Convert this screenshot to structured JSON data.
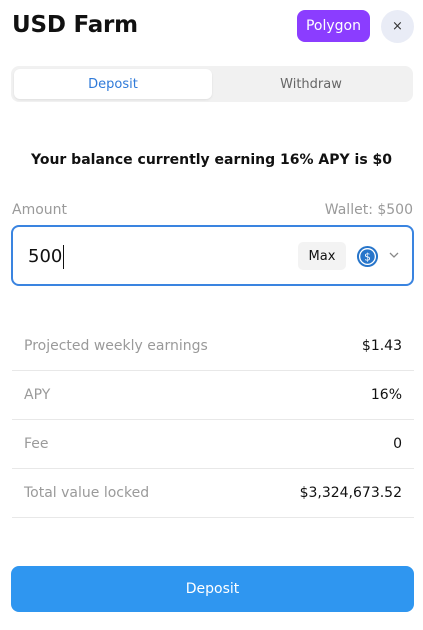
{
  "header": {
    "title": "USD Farm",
    "network_badge": "Polygon",
    "close_label": "×"
  },
  "tabs": [
    {
      "label": "Deposit",
      "active": true
    },
    {
      "label": "Withdraw",
      "active": false
    }
  ],
  "balance_text": "Your balance currently earning 16% APY is $0",
  "amount": {
    "label": "Amount",
    "wallet": "Wallet: $500",
    "value": "500",
    "max_label": "Max",
    "token_icon": "usdc-coin-icon"
  },
  "stats": [
    {
      "label": "Projected weekly earnings",
      "value": "$1.43"
    },
    {
      "label": "APY",
      "value": "16%"
    },
    {
      "label": "Fee",
      "value": "0"
    },
    {
      "label": "Total value locked",
      "value": "$3,324,673.52"
    }
  ],
  "deposit_button": "Deposit",
  "colors": {
    "accent": "#2f96f0",
    "badge": "#8b3dff",
    "input_border": "#3a84e0",
    "active_tab_text": "#2f7ad9"
  }
}
